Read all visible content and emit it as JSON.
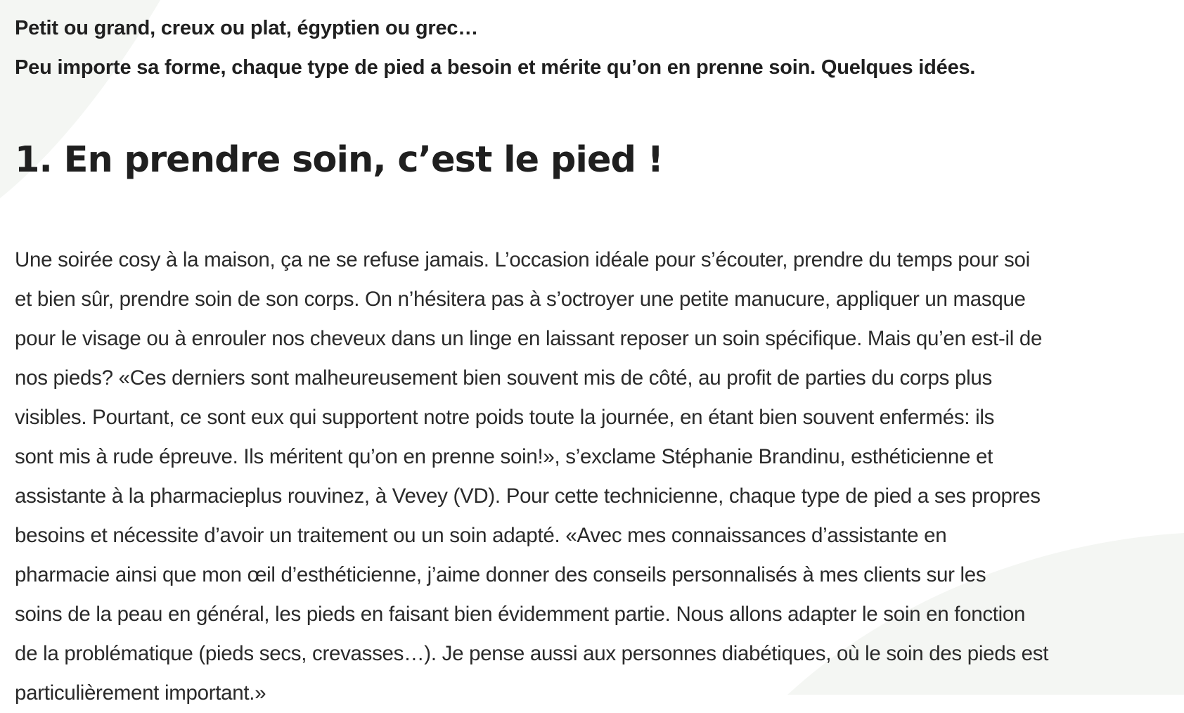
{
  "intro": {
    "line1": "Petit ou grand, creux ou plat, égyptien ou grec…",
    "line2": "Peu importe sa forme, chaque type de pied a besoin et mérite qu’on en prenne soin. Quelques idées."
  },
  "section": {
    "heading": "1. En prendre soin, c’est le pied !"
  },
  "paragraph": {
    "lines": [
      "Une soirée cosy à la maison, ça ne se refuse jamais. L’occasion idéale pour s’écouter, prendre du temps pour soi",
      "et bien sûr, prendre soin de son corps. On n’hésitera pas à s’octroyer une petite manucure, appliquer un masque",
      "pour le visage ou à enrouler nos cheveux dans un linge en laissant reposer un soin spécifique. Mais qu’en est-il de",
      "nos pieds? «Ces derniers sont malheureusement bien souvent mis de côté, au profit de parties du corps plus",
      "visibles. Pourtant, ce sont eux qui supportent notre poids toute la journée, en étant bien souvent enfermés: ils",
      "sont mis à rude épreuve. Ils méritent qu’on en prenne soin!», s’exclame Stéphanie Brandinu, esthéticienne et",
      "assistante à la pharmacieplus rouvinez, à Vevey (VD). Pour cette technicienne, chaque type de pied a ses propres",
      "besoins et nécessite d’avoir un traitement ou un soin adapté. «Avec mes connaissances d’assistante en",
      "pharmacie ainsi que mon œil d’esthéticienne, j’aime donner des conseils personnalisés à mes clients sur les",
      "soins de la peau en général, les pieds en faisant bien évidemment partie. Nous allons adapter le soin en fonction",
      "de la problématique (pieds secs, crevasses…). Je pense aussi aux personnes diabétiques, où le soin des pieds est",
      "particulièrement important.»"
    ]
  },
  "colors": {
    "background": "#ffffff",
    "decor_shape": "#f4f6f3",
    "text": "#1f1f1f"
  }
}
